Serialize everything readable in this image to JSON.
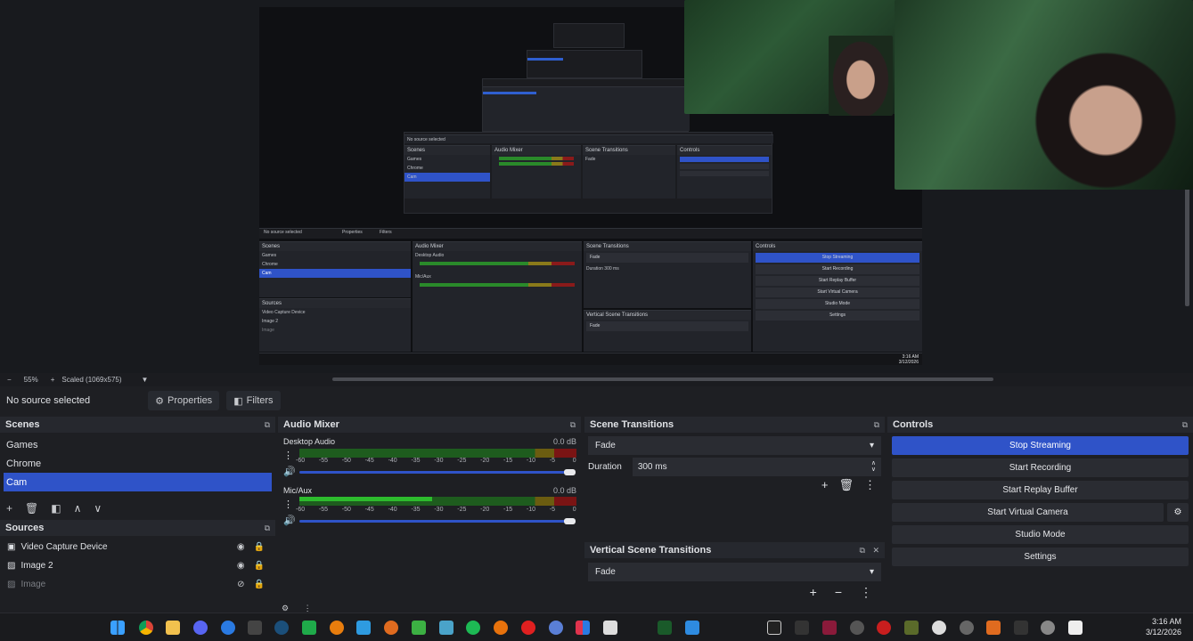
{
  "preview": {
    "zoom_minus": "−",
    "zoom_level": "55%",
    "zoom_plus": "+",
    "scale_label": "Scaled (1069x575)"
  },
  "source_bar": {
    "status": "No source selected",
    "properties_label": "Properties",
    "filters_label": "Filters"
  },
  "scenes": {
    "title": "Scenes",
    "items": [
      "Games",
      "Chrome",
      "Cam"
    ],
    "selected_index": 2
  },
  "sources": {
    "title": "Sources",
    "items": [
      {
        "label": "Video Capture Device",
        "visible": true
      },
      {
        "label": "Image 2",
        "visible": true
      },
      {
        "label": "Image",
        "visible": false
      }
    ]
  },
  "mixer": {
    "title": "Audio Mixer",
    "channels": [
      {
        "name": "Desktop Audio",
        "db": "0.0 dB",
        "level": 0.0
      },
      {
        "name": "Mic/Aux",
        "db": "0.0 dB",
        "level": 0.48
      }
    ],
    "scale": [
      "-60",
      "-55",
      "-50",
      "-45",
      "-40",
      "-35",
      "-30",
      "-25",
      "-20",
      "-15",
      "-10",
      "-5",
      "0"
    ]
  },
  "transitions": {
    "title": "Scene Transitions",
    "selected": "Fade",
    "duration_label": "Duration",
    "duration_value": "300 ms"
  },
  "vertical_transitions": {
    "title": "Vertical Scene Transitions",
    "selected": "Fade"
  },
  "controls": {
    "title": "Controls",
    "buttons": [
      "Stop Streaming",
      "Start Recording",
      "Start Replay Buffer",
      "Start Virtual Camera",
      "Studio Mode",
      "Settings"
    ]
  },
  "clock": {
    "time": "3:16 AM",
    "date": "3/12/2026"
  },
  "mini": {
    "no_source": "No source selected",
    "properties": "Properties",
    "filters": "Filters",
    "scenes": "Scenes",
    "audio_mixer": "Audio Mixer",
    "scene_transitions": "Scene Transitions",
    "controls": "Controls",
    "games": "Games",
    "chrome": "Chrome",
    "cam": "Cam",
    "desktop_audio": "Desktop Audio",
    "mic_aux": "Mic/Aux",
    "fade": "Fade",
    "duration": "Duration",
    "duration_value": "300 ms",
    "sources": "Sources",
    "vcd": "Video Capture Device",
    "image2": "Image 2",
    "image": "Image",
    "vertical": "Vertical Scene Transitions",
    "stop_streaming": "Stop Streaming",
    "start_recording": "Start Recording",
    "start_replay": "Start Replay Buffer",
    "start_virtual": "Start Virtual Camera",
    "studio_mode": "Studio Mode",
    "settings": "Settings",
    "time": "3:16 AM",
    "date": "3/12/2026",
    "db": "0.0 dB"
  },
  "colors": {
    "accent": "#2f53c8",
    "meter_green": "#2dbb2d",
    "meter_yellow": "#6b5c10",
    "meter_red": "#7a1414"
  }
}
